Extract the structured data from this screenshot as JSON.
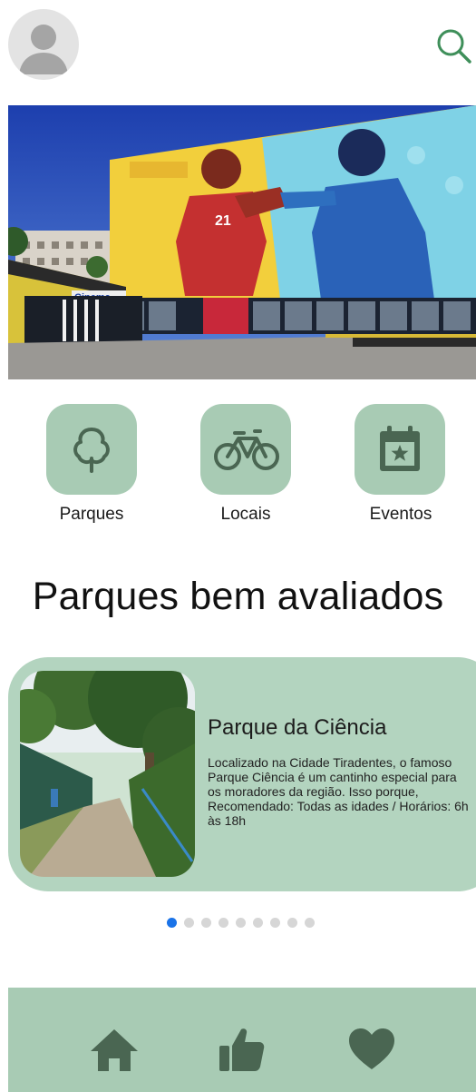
{
  "colors": {
    "accent_green": "#3f8f5a",
    "tile_bg": "#a8cbb4",
    "card_bg": "#b3d4bf",
    "icon_dark": "#4a6652",
    "pager_active": "#1a73e8",
    "pager_inactive": "#d6d6d6"
  },
  "header": {
    "avatar_icon": "user-avatar-icon",
    "search_icon": "search-icon"
  },
  "hero": {
    "sign_text": "Cinema"
  },
  "categories": [
    {
      "label": "Parques",
      "icon": "tree-icon"
    },
    {
      "label": "Locais",
      "icon": "bicycle-icon"
    },
    {
      "label": "Eventos",
      "icon": "calendar-star-icon"
    }
  ],
  "section_title": "Parques bem avaliados",
  "featured_park": {
    "name": "Parque da Ciência",
    "description": "Localizado na Cidade Tiradentes, o famoso Parque Ciência é um cantinho especial para os moradores da região. Isso porque, Recomendado: Todas as idades / Horários: 6h às 18h"
  },
  "pager": {
    "total": 9,
    "active_index": 0
  },
  "bottom_nav": [
    {
      "icon": "home-icon"
    },
    {
      "icon": "thumbs-up-icon"
    },
    {
      "icon": "heart-icon"
    }
  ]
}
